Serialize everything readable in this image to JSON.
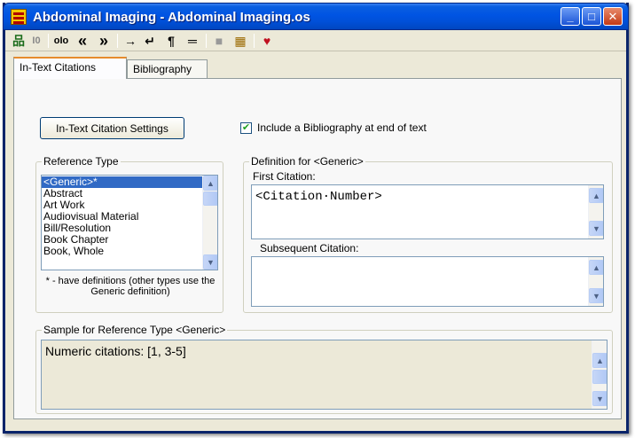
{
  "window": {
    "title": "Abdominal Imaging - Abdominal Imaging.os",
    "controls": {
      "minimize": "_",
      "maximize": "□",
      "close": "✕"
    }
  },
  "toolbar": {
    "icons": [
      {
        "name": "network-icon",
        "glyph": "品"
      },
      {
        "name": "numbered-icon",
        "glyph": "I0"
      },
      {
        "name": "align-icon",
        "glyph": "oIo"
      },
      {
        "name": "move-left-icon",
        "glyph": "«"
      },
      {
        "name": "move-right-icon",
        "glyph": "»"
      },
      {
        "name": "tab-arrow-icon",
        "glyph": "→"
      },
      {
        "name": "return-icon",
        "glyph": "↵"
      },
      {
        "name": "paragraph-icon",
        "glyph": "¶"
      },
      {
        "name": "equals-icon",
        "glyph": "═"
      },
      {
        "name": "block-icon",
        "glyph": "■"
      },
      {
        "name": "grid-icon",
        "glyph": "▦"
      },
      {
        "name": "bookmark-icon",
        "glyph": "♥"
      }
    ]
  },
  "tabs": [
    {
      "label": "In-Text Citations",
      "active": true
    },
    {
      "label": "Bibliography",
      "active": false
    }
  ],
  "settings_button": "In-Text Citation Settings",
  "include_bibliography": {
    "label": "Include a Bibliography at end of text",
    "checked": true,
    "mark": "✔"
  },
  "reference_type": {
    "label": "Reference Type",
    "items": [
      "<Generic>*",
      "Abstract",
      "Art Work",
      "Audiovisual Material",
      "Bill/Resolution",
      "Book Chapter",
      "Book, Whole"
    ],
    "selected": 0,
    "note": "* - have definitions (other types use the Generic definition)"
  },
  "definition": {
    "label": "Definition for <Generic>",
    "first_citation_label": "First Citation:",
    "first_citation_value": "<Citation·Number>",
    "subsequent_citation_label": "Subsequent Citation:",
    "subsequent_citation_value": ""
  },
  "sample": {
    "label": "Sample for Reference Type <Generic>",
    "text": "Numeric citations: [1, 3-5]"
  },
  "colors": {
    "titlebar": "#0054e3",
    "selection": "#316ac5",
    "face": "#ece9d8"
  }
}
